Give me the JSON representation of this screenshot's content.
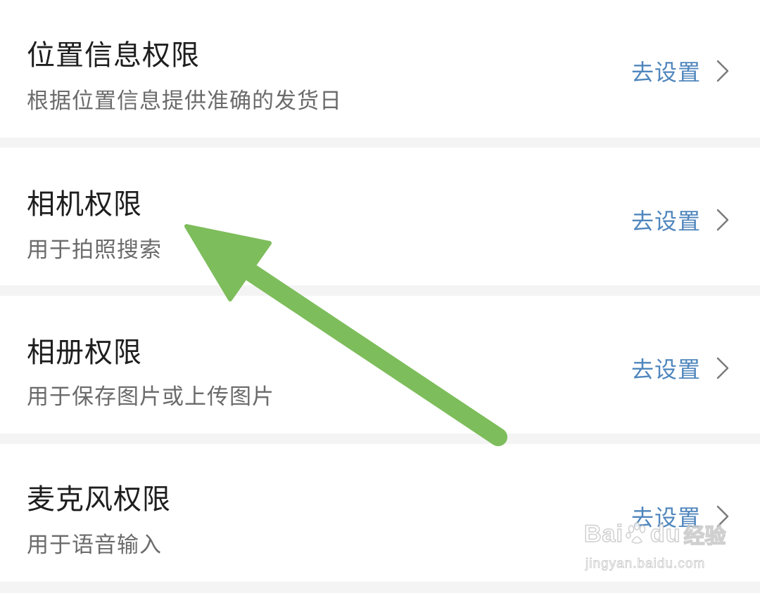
{
  "permissions": [
    {
      "title": "位置信息权限",
      "description": "根据位置信息提供准确的发货日",
      "action_label": "去设置"
    },
    {
      "title": "相机权限",
      "description": "用于拍照搜索",
      "action_label": "去设置"
    },
    {
      "title": "相册权限",
      "description": "用于保存图片或上传图片",
      "action_label": "去设置"
    },
    {
      "title": "麦克风权限",
      "description": "用于语音输入",
      "action_label": "去设置"
    }
  ],
  "icons": {
    "chevron": "chevron-right-icon",
    "annotation": "arrow-annotation-icon",
    "watermark_paw": "paw-icon"
  },
  "colors": {
    "action": "#4f86bd",
    "annotation_arrow": "#7dbd5b",
    "background": "#f4f4f4",
    "card": "#ffffff"
  },
  "watermark": {
    "brand_left": "Bai",
    "brand_right": "du",
    "brand_cn": "经验",
    "url": "jingyan.baidu.com"
  }
}
